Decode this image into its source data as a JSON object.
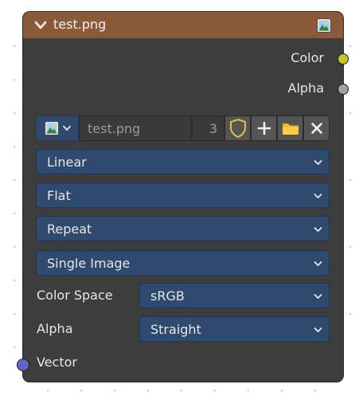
{
  "node": {
    "title": "test.png",
    "header_color": "#8a5a3a",
    "header_icon": "image-icon"
  },
  "outputs": [
    {
      "label": "Color",
      "socket_color": "#c7c729"
    },
    {
      "label": "Alpha",
      "socket_color": "#a1a1a1"
    }
  ],
  "image_selector": {
    "browse_icon": "image-icon",
    "image_name": "test.png",
    "users_count": "3",
    "buttons": [
      "fake-user-shield-icon",
      "new-image-plus-icon",
      "open-folder-icon",
      "unlink-x-icon"
    ]
  },
  "dropdowns": {
    "interpolation": "Linear",
    "projection": "Flat",
    "extension": "Repeat",
    "source": "Single Image"
  },
  "properties": {
    "color_space": {
      "label": "Color Space",
      "value": "sRGB"
    },
    "alpha": {
      "label": "Alpha",
      "value": "Straight"
    }
  },
  "inputs": [
    {
      "label": "Vector",
      "socket_color": "#6363c7"
    }
  ],
  "colors": {
    "node_body": "#3d3d3d",
    "dropdown_blue": "#2f4a6e",
    "canvas_bg": "#ffffff"
  }
}
